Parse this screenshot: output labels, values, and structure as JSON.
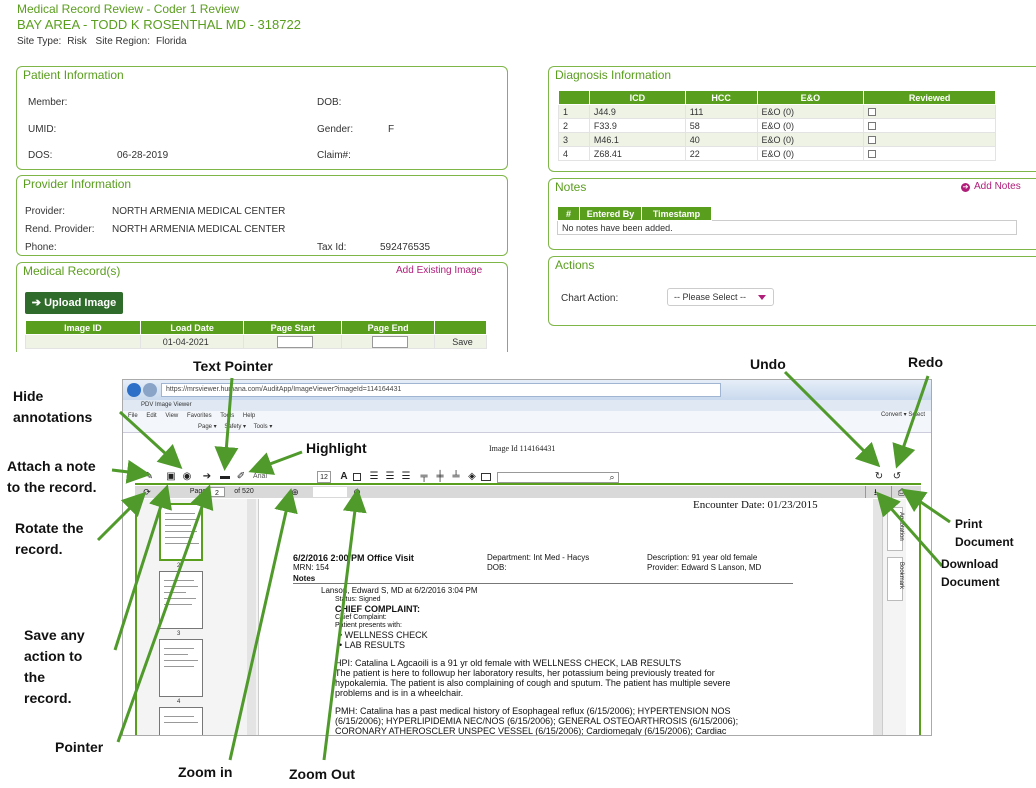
{
  "header": {
    "title": "Medical Record Review - Coder 1 Review",
    "subtitle": "BAY AREA - TODD K ROSENTHAL MD - 318722",
    "site_type_label": "Site Type:",
    "site_type": "Risk",
    "site_region_label": "Site Region:",
    "site_region": "Florida"
  },
  "patient": {
    "title": "Patient Information",
    "member_label": "Member:",
    "dob_label": "DOB:",
    "umid_label": "UMID:",
    "gender_label": "Gender:",
    "gender": "F",
    "dos_label": "DOS:",
    "dos": "06-28-2019",
    "claim_label": "Claim#:"
  },
  "provider": {
    "title": "Provider Information",
    "provider_label": "Provider:",
    "provider": "NORTH ARMENIA MEDICAL CENTER",
    "rend_label": "Rend. Provider:",
    "rend": "NORTH ARMENIA MEDICAL CENTER",
    "phone_label": "Phone:",
    "taxid_label": "Tax Id:",
    "taxid": "592476535"
  },
  "records": {
    "title": "Medical Record(s)",
    "add_existing": "Add Existing Image",
    "upload": "Upload Image",
    "columns": [
      "Image ID",
      "Load Date",
      "Page Start",
      "Page End",
      ""
    ],
    "row": {
      "load_date": "01-04-2021",
      "save": "Save"
    }
  },
  "diagnosis": {
    "title": "Diagnosis Information",
    "columns": [
      "",
      "ICD",
      "HCC",
      "E&O",
      "Reviewed"
    ],
    "rows": [
      {
        "n": "1",
        "icd": "J44.9",
        "hcc": "111",
        "eo": "E&O (0)"
      },
      {
        "n": "2",
        "icd": "F33.9",
        "hcc": "58",
        "eo": "E&O (0)"
      },
      {
        "n": "3",
        "icd": "M46.1",
        "hcc": "40",
        "eo": "E&O (0)"
      },
      {
        "n": "4",
        "icd": "Z68.41",
        "hcc": "22",
        "eo": "E&O (0)"
      }
    ]
  },
  "notes": {
    "title": "Notes",
    "add": "Add Notes",
    "columns": [
      "#",
      "Entered By",
      "Timestamp"
    ],
    "empty": "No notes have been added."
  },
  "actions": {
    "title": "Actions",
    "chart_action_label": "Chart Action:",
    "select_value": "-- Please Select --"
  },
  "viewer": {
    "address": "https://mrsviewer.humana.com/AuditApp/ImageViewer?imageId=114164431",
    "tab": "PDV Image Viewer",
    "menu": [
      "File",
      "Edit",
      "View",
      "Favorites",
      "Tools",
      "Help"
    ],
    "cmd": [
      "Page ▾",
      "Safety ▾",
      "Tools ▾"
    ],
    "right_cmd": "Convert ▾   Select",
    "image_id": "Image Id  114164431",
    "font": "Arial",
    "font_size": "12",
    "page_label": "Page",
    "page_value": "2",
    "page_of": "of 520",
    "encounter": "Encounter Date: 01/23/2015",
    "side_tabs": [
      "Annotation",
      "Bookmark"
    ],
    "thumb_numbers": [
      "2",
      "3",
      "4"
    ],
    "doc": {
      "visit": "6/2/2016  2:00 PM   Office Visit",
      "department": "Department: Int Med - Hacys",
      "description": "Description: 91 year old female",
      "mrn": "MRN: 154",
      "dob": "DOB:",
      "provider": "Provider: Edward S Lanson, MD",
      "notes_tab": "Notes",
      "signer": "Lanson, Edward S, MD at 6/2/2016  3:04 PM",
      "status": "Status: Signed",
      "cc_title": "CHIEF COMPLAINT:",
      "cc_label": "Chief Complaint:",
      "cc_presents": "Patient presents with:",
      "cc_item1": "WELLNESS CHECK",
      "cc_item2": "LAB RESULTS",
      "hpi1": "HPI: Catalina L Agcaoili is a 91 yr old female with WELLNESS CHECK, LAB RESULTS",
      "hpi2": "The patient is here to followup her laboratory results, her potassium being previously treated for",
      "hpi3": "hypokalemia. The patient is also complaining of cough and sputum. The patient has multiple severe",
      "hpi4": "problems and is in a wheelchair.",
      "pmh1": "PMH: Catalina  has a past medical history of Esophageal reflux (6/15/2006); HYPERTENSION NOS",
      "pmh2": "(6/15/2006); HYPERLIPIDEMIA NEC/NOS (6/15/2006); GENERAL OSTEOARTHROSIS (6/15/2006);",
      "pmh3": "CORONARY ATHEROSCLER UNSPEC VESSEL (6/15/2006); Cardiomegaly (6/15/2006); Cardiac"
    }
  },
  "annotations": {
    "text_pointer": "Text Pointer",
    "undo": "Undo",
    "redo": "Redo",
    "hide": "Hide\nannotations",
    "highlight": "Highlight",
    "attach": "Attach a note\nto the record.",
    "rotate": "Rotate the\nrecord.",
    "print": "Print\nDocument",
    "download": "Download\nDocument",
    "save": "Save any\naction to\nthe\nrecord.",
    "pointer": "Pointer",
    "zoom_in": "Zoom in",
    "zoom_out": "Zoom Out"
  }
}
